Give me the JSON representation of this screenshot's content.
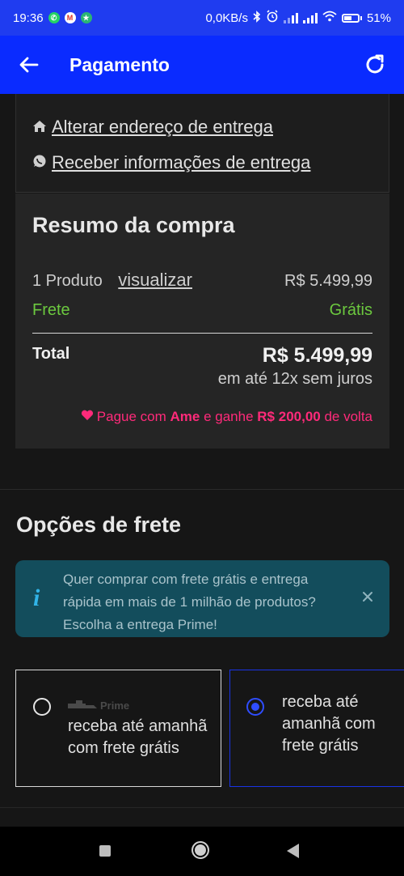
{
  "status_bar": {
    "time": "19:36",
    "network_speed": "0,0KB/s",
    "battery": "51%",
    "battery_level": 0.51,
    "icons": [
      "whatsapp-icon",
      "gmail-icon",
      "app-icon",
      "bluetooth-icon",
      "alarm-icon",
      "signal-icon",
      "wifi-icon",
      "battery-icon"
    ]
  },
  "app_bar": {
    "title": "Pagamento",
    "back_icon": "arrow-left-icon",
    "refresh_icon": "refresh-icon",
    "color": "#0a2bff"
  },
  "delivery_links": {
    "change_address": "Alterar endereço de entrega",
    "receive_info": "Receber informações de entrega"
  },
  "summary": {
    "title": "Resumo da compra",
    "product_label": "1 Produto",
    "view_link": "visualizar",
    "product_price": "R$ 5.499,99",
    "shipping_label": "Frete",
    "shipping_value": "Grátis",
    "total_label": "Total",
    "total_value": "R$ 5.499,99",
    "installments": "em até 12x sem juros",
    "ame_prefix": "Pague com ",
    "ame_brand": "Ame",
    "ame_middle": " e ganhe ",
    "ame_amount": "R$ 200,00",
    "ame_suffix": " de volta",
    "accent_green": "#6cc93f",
    "accent_pink": "#ff2a7a"
  },
  "shipping": {
    "title": "Opções de frete",
    "info_text": "Quer comprar com frete grátis e entrega rápida em mais de 1 milhão de produtos? Escolha a entrega Prime!",
    "options": [
      {
        "badge": "Prime",
        "text": "receba até amanhã com frete grátis",
        "selected": false
      },
      {
        "text": "receba até amanhã com frete grátis",
        "selected": true
      }
    ]
  }
}
